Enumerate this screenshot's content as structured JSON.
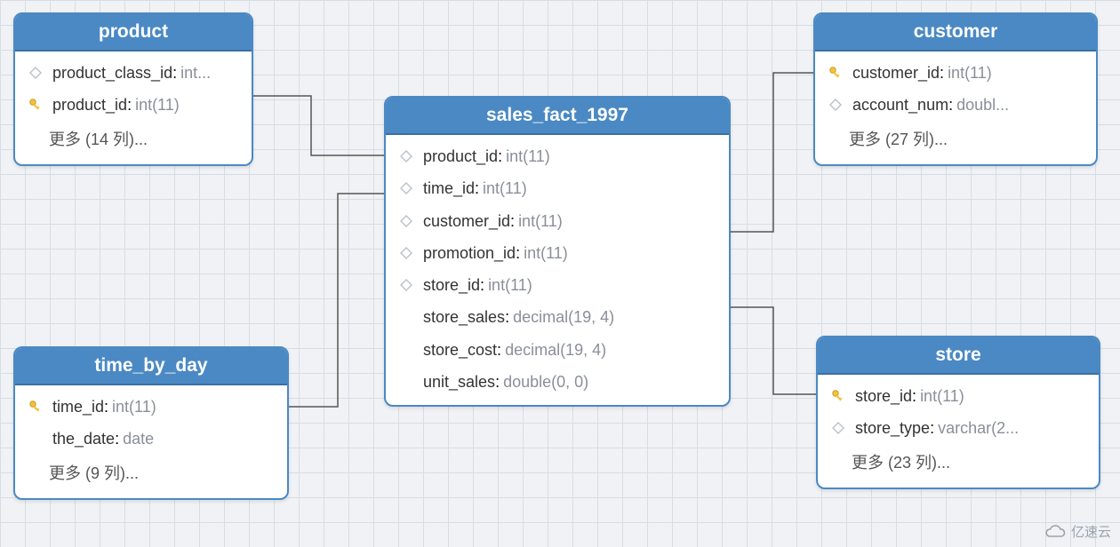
{
  "tables": {
    "product": {
      "title": "product",
      "fields": [
        {
          "icon": "diamond",
          "name": "product_class_id",
          "type": "int..."
        },
        {
          "icon": "key",
          "name": "product_id",
          "type": "int(11)"
        }
      ],
      "more": "更多 (14 列)..."
    },
    "time_by_day": {
      "title": "time_by_day",
      "fields": [
        {
          "icon": "key",
          "name": "time_id",
          "type": "int(11)"
        },
        {
          "icon": "blank",
          "name": "the_date",
          "type": "date"
        }
      ],
      "more": "更多 (9 列)..."
    },
    "sales_fact_1997": {
      "title": "sales_fact_1997",
      "fields": [
        {
          "icon": "diamond",
          "name": "product_id",
          "type": "int(11)"
        },
        {
          "icon": "diamond",
          "name": "time_id",
          "type": "int(11)"
        },
        {
          "icon": "diamond",
          "name": "customer_id",
          "type": "int(11)"
        },
        {
          "icon": "diamond",
          "name": "promotion_id",
          "type": "int(11)"
        },
        {
          "icon": "diamond",
          "name": "store_id",
          "type": "int(11)"
        },
        {
          "icon": "blank",
          "name": "store_sales",
          "type": "decimal(19, 4)"
        },
        {
          "icon": "blank",
          "name": "store_cost",
          "type": "decimal(19, 4)"
        },
        {
          "icon": "blank",
          "name": "unit_sales",
          "type": "double(0, 0)"
        }
      ]
    },
    "customer": {
      "title": "customer",
      "fields": [
        {
          "icon": "key",
          "name": "customer_id",
          "type": "int(11)"
        },
        {
          "icon": "diamond",
          "name": "account_num",
          "type": "doubl..."
        }
      ],
      "more": "更多 (27 列)..."
    },
    "store": {
      "title": "store",
      "fields": [
        {
          "icon": "key",
          "name": "store_id",
          "type": "int(11)"
        },
        {
          "icon": "diamond",
          "name": "store_type",
          "type": "varchar(2..."
        }
      ],
      "more": "更多 (23 列)..."
    }
  },
  "watermark": "亿速云"
}
